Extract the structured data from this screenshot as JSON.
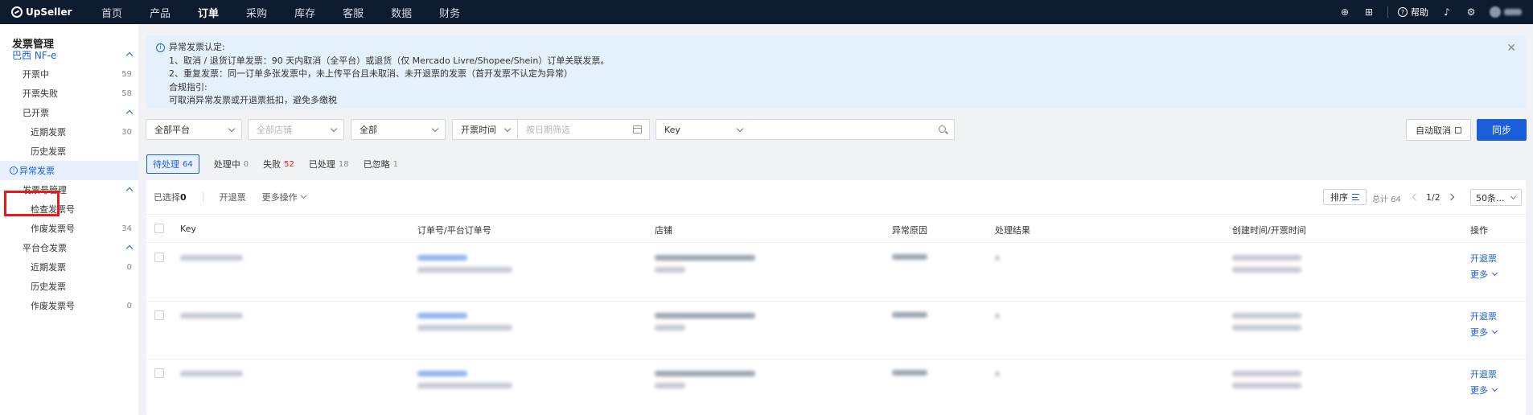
{
  "topnav": {
    "logo": "UpSeller",
    "items": [
      "首页",
      "产品",
      "订单",
      "采购",
      "库存",
      "客服",
      "数据",
      "财务"
    ],
    "active_index": 2,
    "help_label": "帮助",
    "help_icon_glyph": "?",
    "globe_icon_glyph": "⊕",
    "grid_icon_glyph": "⊞",
    "bell_icon_glyph": "♪",
    "gear_icon_glyph": "⚙"
  },
  "sidebar": {
    "title": "发票管理",
    "items": [
      {
        "label": "巴西 NF-e",
        "type": "group",
        "count": ""
      },
      {
        "label": "开票中",
        "type": "item",
        "count": "59"
      },
      {
        "label": "开票失败",
        "type": "item",
        "count": "58"
      },
      {
        "label": "已开票",
        "type": "subgroup",
        "count": ""
      },
      {
        "label": "近期发票",
        "type": "sub",
        "count": "30"
      },
      {
        "label": "历史发票",
        "type": "sub",
        "count": ""
      },
      {
        "label": "异常发票",
        "type": "selected",
        "count": "",
        "icon_glyph": "!"
      },
      {
        "label": "发票号管理",
        "type": "subgroup",
        "count": ""
      },
      {
        "label": "检查发票号",
        "type": "sub",
        "count": ""
      },
      {
        "label": "作废发票号",
        "type": "sub",
        "count": "34"
      },
      {
        "label": "平台仓发票",
        "type": "subgroup",
        "count": ""
      },
      {
        "label": "近期发票",
        "type": "sub",
        "count": "0"
      },
      {
        "label": "历史发票",
        "type": "sub",
        "count": ""
      },
      {
        "label": "作废发票号",
        "type": "sub",
        "count": "0"
      }
    ]
  },
  "alert": {
    "title": "异常发票认定:",
    "line1": "1、取消 / 退货订单发票：90 天内取消（全平台）或退货（仅 Mercado Livre/Shopee/Shein）订单关联发票。",
    "line2": "2、重复发票：同一订单多张发票中，未上传平台且未取消、未开退票的发票（首开发票不认定为异常）",
    "line3": "合规指引:",
    "line4": "可取消异常发票或开退票抵扣，避免多缴税",
    "info_glyph": "i",
    "close_glyph": "✕"
  },
  "filters": {
    "platform": "全部平台",
    "store_placeholder": "全部店铺",
    "status": "全部",
    "time_type": "开票时间",
    "date_placeholder": "按日期筛选",
    "key_type": "Key",
    "key_value": ""
  },
  "buttons": {
    "auto_cancel": "自动取消",
    "sync": "同步"
  },
  "tabs": [
    {
      "label": "待处理",
      "count": "64"
    },
    {
      "label": "处理中",
      "count": "0"
    },
    {
      "label": "失败",
      "count": "52"
    },
    {
      "label": "已处理",
      "count": "18"
    },
    {
      "label": "已忽略",
      "count": "1"
    }
  ],
  "toolbar": {
    "selected_label": "已选择",
    "selected_count": "0",
    "refund_label": "开退票",
    "more_label": "更多操作",
    "sort_label": "排序",
    "total_label": "总计 64",
    "page_text": "1/2",
    "page_size": "50条..."
  },
  "table": {
    "columns": [
      "Key",
      "订单号/平台订单号",
      "店铺",
      "异常原因",
      "处理结果",
      "创建时间/开票时间",
      "操作"
    ],
    "row_actions": {
      "refund": "开退票",
      "more": "更多"
    },
    "row_count": 3
  },
  "colors": {
    "nav_bg": "#0d1b2e",
    "brand_blue": "#1a5fd9",
    "alert_bg": "#e4f0fc",
    "highlight_red": "#e8191b"
  }
}
